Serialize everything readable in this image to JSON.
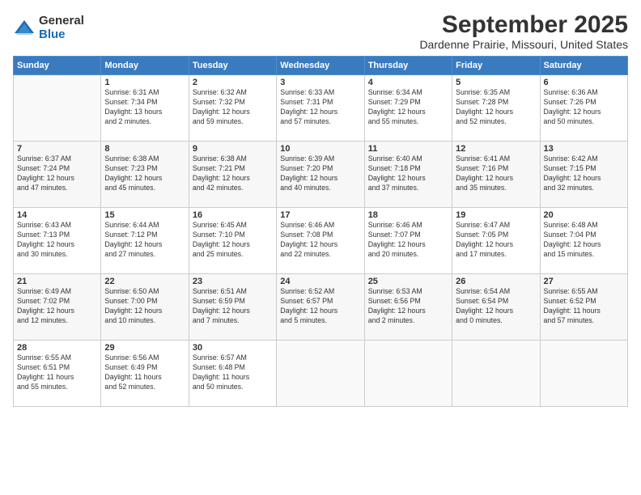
{
  "logo": {
    "general": "General",
    "blue": "Blue"
  },
  "title": "September 2025",
  "location": "Dardenne Prairie, Missouri, United States",
  "weekdays": [
    "Sunday",
    "Monday",
    "Tuesday",
    "Wednesday",
    "Thursday",
    "Friday",
    "Saturday"
  ],
  "weeks": [
    [
      {
        "day": "",
        "info": ""
      },
      {
        "day": "1",
        "info": "Sunrise: 6:31 AM\nSunset: 7:34 PM\nDaylight: 13 hours\nand 2 minutes."
      },
      {
        "day": "2",
        "info": "Sunrise: 6:32 AM\nSunset: 7:32 PM\nDaylight: 12 hours\nand 59 minutes."
      },
      {
        "day": "3",
        "info": "Sunrise: 6:33 AM\nSunset: 7:31 PM\nDaylight: 12 hours\nand 57 minutes."
      },
      {
        "day": "4",
        "info": "Sunrise: 6:34 AM\nSunset: 7:29 PM\nDaylight: 12 hours\nand 55 minutes."
      },
      {
        "day": "5",
        "info": "Sunrise: 6:35 AM\nSunset: 7:28 PM\nDaylight: 12 hours\nand 52 minutes."
      },
      {
        "day": "6",
        "info": "Sunrise: 6:36 AM\nSunset: 7:26 PM\nDaylight: 12 hours\nand 50 minutes."
      }
    ],
    [
      {
        "day": "7",
        "info": "Sunrise: 6:37 AM\nSunset: 7:24 PM\nDaylight: 12 hours\nand 47 minutes."
      },
      {
        "day": "8",
        "info": "Sunrise: 6:38 AM\nSunset: 7:23 PM\nDaylight: 12 hours\nand 45 minutes."
      },
      {
        "day": "9",
        "info": "Sunrise: 6:38 AM\nSunset: 7:21 PM\nDaylight: 12 hours\nand 42 minutes."
      },
      {
        "day": "10",
        "info": "Sunrise: 6:39 AM\nSunset: 7:20 PM\nDaylight: 12 hours\nand 40 minutes."
      },
      {
        "day": "11",
        "info": "Sunrise: 6:40 AM\nSunset: 7:18 PM\nDaylight: 12 hours\nand 37 minutes."
      },
      {
        "day": "12",
        "info": "Sunrise: 6:41 AM\nSunset: 7:16 PM\nDaylight: 12 hours\nand 35 minutes."
      },
      {
        "day": "13",
        "info": "Sunrise: 6:42 AM\nSunset: 7:15 PM\nDaylight: 12 hours\nand 32 minutes."
      }
    ],
    [
      {
        "day": "14",
        "info": "Sunrise: 6:43 AM\nSunset: 7:13 PM\nDaylight: 12 hours\nand 30 minutes."
      },
      {
        "day": "15",
        "info": "Sunrise: 6:44 AM\nSunset: 7:12 PM\nDaylight: 12 hours\nand 27 minutes."
      },
      {
        "day": "16",
        "info": "Sunrise: 6:45 AM\nSunset: 7:10 PM\nDaylight: 12 hours\nand 25 minutes."
      },
      {
        "day": "17",
        "info": "Sunrise: 6:46 AM\nSunset: 7:08 PM\nDaylight: 12 hours\nand 22 minutes."
      },
      {
        "day": "18",
        "info": "Sunrise: 6:46 AM\nSunset: 7:07 PM\nDaylight: 12 hours\nand 20 minutes."
      },
      {
        "day": "19",
        "info": "Sunrise: 6:47 AM\nSunset: 7:05 PM\nDaylight: 12 hours\nand 17 minutes."
      },
      {
        "day": "20",
        "info": "Sunrise: 6:48 AM\nSunset: 7:04 PM\nDaylight: 12 hours\nand 15 minutes."
      }
    ],
    [
      {
        "day": "21",
        "info": "Sunrise: 6:49 AM\nSunset: 7:02 PM\nDaylight: 12 hours\nand 12 minutes."
      },
      {
        "day": "22",
        "info": "Sunrise: 6:50 AM\nSunset: 7:00 PM\nDaylight: 12 hours\nand 10 minutes."
      },
      {
        "day": "23",
        "info": "Sunrise: 6:51 AM\nSunset: 6:59 PM\nDaylight: 12 hours\nand 7 minutes."
      },
      {
        "day": "24",
        "info": "Sunrise: 6:52 AM\nSunset: 6:57 PM\nDaylight: 12 hours\nand 5 minutes."
      },
      {
        "day": "25",
        "info": "Sunrise: 6:53 AM\nSunset: 6:56 PM\nDaylight: 12 hours\nand 2 minutes."
      },
      {
        "day": "26",
        "info": "Sunrise: 6:54 AM\nSunset: 6:54 PM\nDaylight: 12 hours\nand 0 minutes."
      },
      {
        "day": "27",
        "info": "Sunrise: 6:55 AM\nSunset: 6:52 PM\nDaylight: 11 hours\nand 57 minutes."
      }
    ],
    [
      {
        "day": "28",
        "info": "Sunrise: 6:55 AM\nSunset: 6:51 PM\nDaylight: 11 hours\nand 55 minutes."
      },
      {
        "day": "29",
        "info": "Sunrise: 6:56 AM\nSunset: 6:49 PM\nDaylight: 11 hours\nand 52 minutes."
      },
      {
        "day": "30",
        "info": "Sunrise: 6:57 AM\nSunset: 6:48 PM\nDaylight: 11 hours\nand 50 minutes."
      },
      {
        "day": "",
        "info": ""
      },
      {
        "day": "",
        "info": ""
      },
      {
        "day": "",
        "info": ""
      },
      {
        "day": "",
        "info": ""
      }
    ]
  ]
}
